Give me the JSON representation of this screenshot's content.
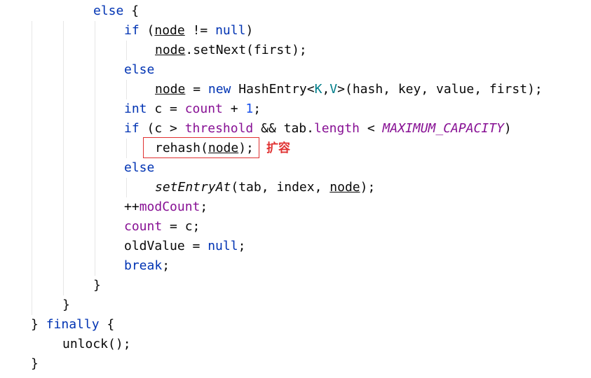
{
  "code": {
    "l1": [
      "else",
      " {"
    ],
    "l2": [
      "if",
      " (",
      "node",
      " != ",
      "null",
      ")"
    ],
    "l3": [
      "node",
      ".setNext(first);"
    ],
    "l4": [
      "else"
    ],
    "l5": [
      "node",
      " = ",
      "new",
      " HashEntry<",
      "K",
      ",",
      "V",
      ">(hash, key, value, first);"
    ],
    "l6": [
      "int",
      " c = ",
      "count",
      " + ",
      "1",
      ";"
    ],
    "l7": [
      "if",
      " (c > ",
      "threshold",
      " && tab.",
      "length",
      " < ",
      "MAXIMUM_CAPACITY",
      ")"
    ],
    "l8": [
      "rehash(",
      "node",
      ");"
    ],
    "l9": [
      "else"
    ],
    "l10": [
      "setEntryAt",
      "(tab, index, ",
      "node",
      ");"
    ],
    "l11": [
      "++",
      "modCount",
      ";"
    ],
    "l12": [
      "count",
      " = c;"
    ],
    "l13": [
      "oldValue = ",
      "null",
      ";"
    ],
    "l14": [
      "break",
      ";"
    ],
    "l15": [
      "}"
    ],
    "l16": [
      "}"
    ],
    "l17": [
      "} ",
      "finally",
      " {"
    ],
    "l18": [
      "unlock();"
    ],
    "l19": [
      "}"
    ]
  },
  "annotation": {
    "text": "扩容",
    "color": "#e03131"
  },
  "colors": {
    "keyword": "#0033b3",
    "field": "#871094",
    "number": "#1750eb",
    "generic": "#007e8a",
    "text": "#080808",
    "background": "#ffffff"
  }
}
